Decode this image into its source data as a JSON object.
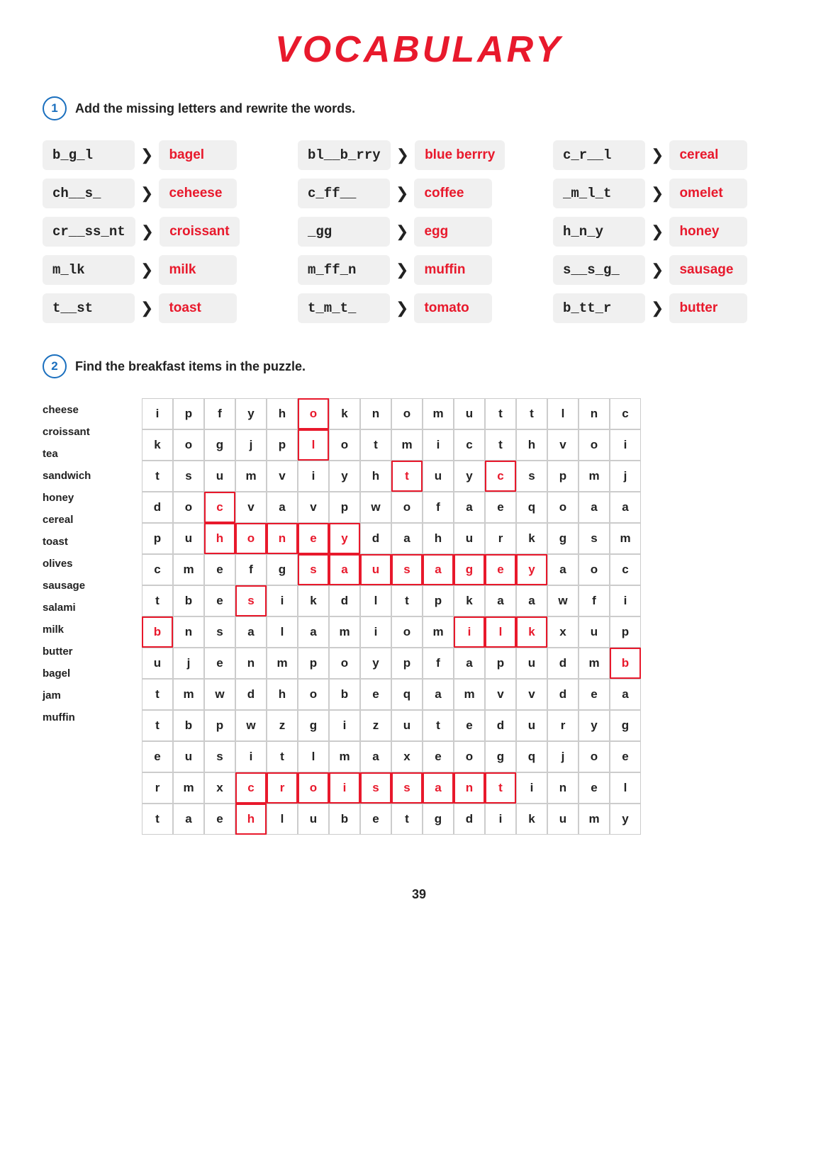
{
  "title": "VOCABULARY",
  "section1": {
    "number": "1",
    "instruction": "Add the missing letters and rewrite the words.",
    "items": [
      {
        "word": "b_g_l",
        "answer": "bagel"
      },
      {
        "word": "bl__b_rry",
        "answer": "blue berrry"
      },
      {
        "word": "c_r__l",
        "answer": "cereal"
      },
      {
        "word": "ch__s_",
        "answer": "ceheese"
      },
      {
        "word": "c_ff__",
        "answer": "coffee"
      },
      {
        "word": "_m_l_t",
        "answer": "omelet"
      },
      {
        "word": "cr__ss_nt",
        "answer": "croissant"
      },
      {
        "word": "_gg",
        "answer": "egg"
      },
      {
        "word": "h_n_y",
        "answer": "honey"
      },
      {
        "word": "m_lk",
        "answer": "milk"
      },
      {
        "word": "m_ff_n",
        "answer": "muffin"
      },
      {
        "word": "s__s_g_",
        "answer": "sausage"
      },
      {
        "word": "t__st",
        "answer": "toast"
      },
      {
        "word": "t_m_t_",
        "answer": "tomato"
      },
      {
        "word": "b_tt_r",
        "answer": "butter"
      }
    ]
  },
  "section2": {
    "number": "2",
    "instruction": "Find the breakfast items in the puzzle.",
    "wordList": [
      "cheese",
      "croissant",
      "tea",
      "sandwich",
      "honey",
      "cereal",
      "toast",
      "olives",
      "sausage",
      "salami",
      "milk",
      "butter",
      "bagel",
      "jam",
      "muffin"
    ],
    "grid": [
      [
        "i",
        "p",
        "f",
        "y",
        "h",
        "o",
        "k",
        "n",
        "o",
        "m",
        "u",
        "t",
        "t",
        "l",
        "n",
        "c"
      ],
      [
        "k",
        "o",
        "g",
        "j",
        "p",
        "l",
        "o",
        "t",
        "m",
        "i",
        "c",
        "t",
        "h",
        "v",
        "o",
        "i"
      ],
      [
        "t",
        "s",
        "u",
        "m",
        "v",
        "i",
        "y",
        "h",
        "t",
        "u",
        "y",
        "c",
        "s",
        "p",
        "m",
        "j"
      ],
      [
        "d",
        "o",
        "c",
        "v",
        "a",
        "v",
        "p",
        "w",
        "o",
        "f",
        "a",
        "e",
        "q",
        "o",
        "a",
        "a"
      ],
      [
        "p",
        "u",
        "h",
        "o",
        "n",
        "e",
        "y",
        "d",
        "a",
        "h",
        "u",
        "r",
        "k",
        "g",
        "s",
        "m"
      ],
      [
        "c",
        "m",
        "e",
        "f",
        "g",
        "s",
        "a",
        "u",
        "s",
        "a",
        "g",
        "e",
        "y",
        "a",
        "o",
        "c"
      ],
      [
        "t",
        "b",
        "e",
        "s",
        "i",
        "k",
        "d",
        "l",
        "t",
        "p",
        "k",
        "a",
        "a",
        "w",
        "f",
        "i"
      ],
      [
        "b",
        "n",
        "s",
        "a",
        "l",
        "a",
        "m",
        "i",
        "o",
        "m",
        "i",
        "l",
        "k",
        "x",
        "u",
        "p"
      ],
      [
        "u",
        "j",
        "e",
        "n",
        "m",
        "p",
        "o",
        "y",
        "p",
        "f",
        "a",
        "p",
        "u",
        "d",
        "m",
        "b"
      ],
      [
        "t",
        "m",
        "w",
        "d",
        "h",
        "o",
        "b",
        "e",
        "q",
        "a",
        "m",
        "v",
        "v",
        "d",
        "e",
        "a"
      ],
      [
        "t",
        "b",
        "p",
        "w",
        "z",
        "g",
        "i",
        "z",
        "u",
        "t",
        "e",
        "d",
        "u",
        "r",
        "y",
        "g"
      ],
      [
        "e",
        "u",
        "s",
        "i",
        "t",
        "l",
        "m",
        "a",
        "x",
        "e",
        "o",
        "g",
        "q",
        "j",
        "o",
        "e"
      ],
      [
        "r",
        "m",
        "x",
        "c",
        "r",
        "o",
        "i",
        "s",
        "s",
        "a",
        "n",
        "t",
        "i",
        "n",
        "e",
        "l"
      ],
      [
        "t",
        "a",
        "e",
        "h",
        "l",
        "u",
        "b",
        "e",
        "t",
        "g",
        "d",
        "i",
        "k",
        "u",
        "m",
        "y"
      ]
    ],
    "highlighted": [
      {
        "row": 0,
        "col": 5
      },
      {
        "row": 1,
        "col": 5
      },
      {
        "row": 2,
        "col": 8
      },
      {
        "row": 2,
        "col": 11
      },
      {
        "row": 3,
        "col": 2
      },
      {
        "row": 4,
        "col": 2
      },
      {
        "row": 4,
        "col": 3
      },
      {
        "row": 4,
        "col": 4
      },
      {
        "row": 4,
        "col": 5
      },
      {
        "row": 4,
        "col": 6
      },
      {
        "row": 5,
        "col": 5
      },
      {
        "row": 5,
        "col": 6
      },
      {
        "row": 5,
        "col": 7
      },
      {
        "row": 5,
        "col": 8
      },
      {
        "row": 5,
        "col": 9
      },
      {
        "row": 5,
        "col": 10
      },
      {
        "row": 5,
        "col": 11
      },
      {
        "row": 5,
        "col": 12
      },
      {
        "row": 6,
        "col": 3
      },
      {
        "row": 7,
        "col": 0
      },
      {
        "row": 7,
        "col": 10
      },
      {
        "row": 7,
        "col": 11
      },
      {
        "row": 7,
        "col": 12
      },
      {
        "row": 8,
        "col": 15
      },
      {
        "row": 12,
        "col": 3
      },
      {
        "row": 12,
        "col": 4
      },
      {
        "row": 12,
        "col": 5
      },
      {
        "row": 12,
        "col": 6
      },
      {
        "row": 12,
        "col": 7
      },
      {
        "row": 12,
        "col": 8
      },
      {
        "row": 12,
        "col": 9
      },
      {
        "row": 12,
        "col": 10
      },
      {
        "row": 12,
        "col": 11
      },
      {
        "row": 13,
        "col": 3
      }
    ]
  },
  "pageNumber": "39"
}
